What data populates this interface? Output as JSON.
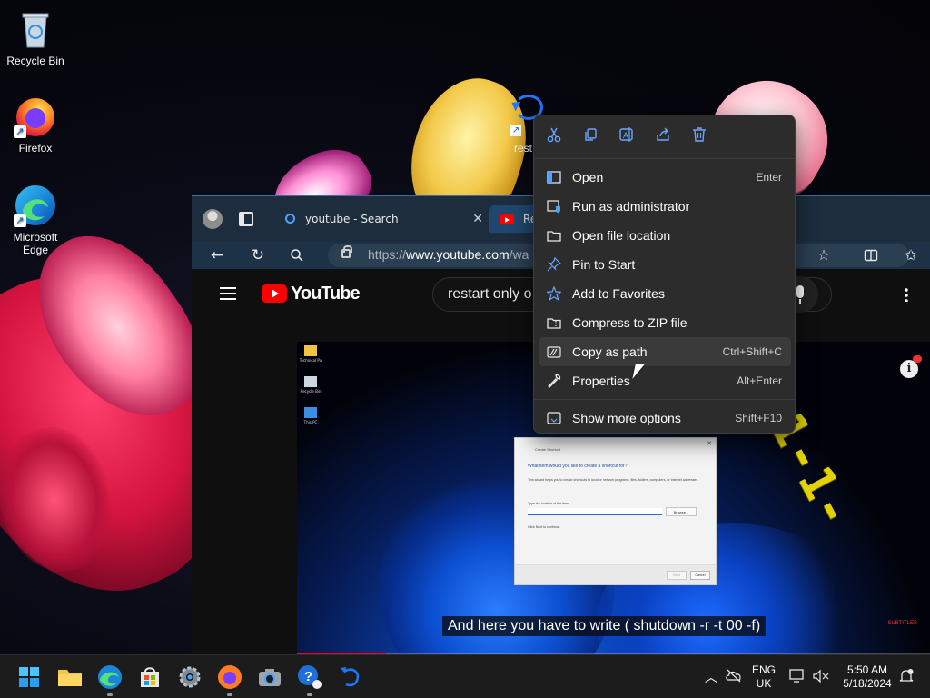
{
  "desktop": {
    "icons": [
      {
        "label": "Recycle Bin",
        "icon": "recycle-bin-icon"
      },
      {
        "label": "Firefox",
        "icon": "firefox-icon"
      },
      {
        "label": "Microsoft\nEdge",
        "label_line1": "Microsoft",
        "label_line2": "Edge",
        "icon": "edge-icon"
      }
    ],
    "selected_shortcut_label": "rest"
  },
  "browser": {
    "tabs": [
      {
        "title": "youtube - Search",
        "close": "✕"
      },
      {
        "title": "Re"
      }
    ],
    "url_prefix": "https://",
    "url_domain": "www.youtube.com",
    "url_path": "/wa",
    "icons": [
      "back-icon",
      "refresh-icon",
      "search-icon",
      "lock-icon",
      "favorite-star-icon",
      "split-screen-icon",
      "favorites-icon"
    ]
  },
  "youtube": {
    "logo_text": "YouTube",
    "search_text": "restart only o",
    "video_digits": "001-1-",
    "subtitle": "And here you have to write ( shutdown -r -t 00 -f)",
    "watermark": "SUBTITLES",
    "progress_fraction": 0.14,
    "desktop_icons_in_video": [
      "Technical Pu",
      "Recycle Bin",
      "This PC"
    ],
    "dialog": {
      "title": "Create Shortcut",
      "close": "✕",
      "heading": "What item would you like to create a shortcut for?",
      "body": "This wizard helps you to create shortcuts to local or network programs, files, folders, computers, or Internet addresses.",
      "field_label": "Type the location of the item:",
      "browse": "Browse...",
      "hint": "Click Next to continue.",
      "next": "Next",
      "cancel": "Cancel"
    }
  },
  "context_menu": {
    "quick_actions": [
      "cut-icon",
      "copy-icon",
      "rename-icon",
      "share-icon",
      "delete-icon"
    ],
    "items": [
      {
        "label": "Open",
        "shortcut": "Enter",
        "icon": "open-icon"
      },
      {
        "label": "Run as administrator",
        "shortcut": "",
        "icon": "shield-icon"
      },
      {
        "label": "Open file location",
        "shortcut": "",
        "icon": "folder-icon"
      },
      {
        "label": "Pin to Start",
        "shortcut": "",
        "icon": "pin-icon"
      },
      {
        "label": "Add to Favorites",
        "shortcut": "",
        "icon": "star-icon"
      },
      {
        "label": "Compress to ZIP file",
        "shortcut": "",
        "icon": "zip-folder-icon"
      },
      {
        "label": "Copy as path",
        "shortcut": "Ctrl+Shift+C",
        "icon": "copy-path-icon"
      },
      {
        "label": "Properties",
        "shortcut": "Alt+Enter",
        "icon": "wrench-icon"
      },
      {
        "label": "Show more options",
        "shortcut": "Shift+F10",
        "icon": "more-options-icon"
      }
    ],
    "hovered_index": 6
  },
  "taskbar": {
    "apps": [
      "start-icon",
      "file-explorer-icon",
      "edge-icon",
      "store-icon",
      "settings-icon",
      "firefox-icon",
      "camera-icon",
      "help-icon",
      "undo-app-icon"
    ],
    "tray": {
      "language_line1": "ENG",
      "language_line2": "UK",
      "time": "5:50 AM",
      "date": "5/18/2024"
    }
  },
  "colors": {
    "accent": "#4ea3ff",
    "youtube_red": "#ff0000",
    "menu_bg": "#2c2c2c",
    "taskbar_bg": "#1c1c1c"
  }
}
